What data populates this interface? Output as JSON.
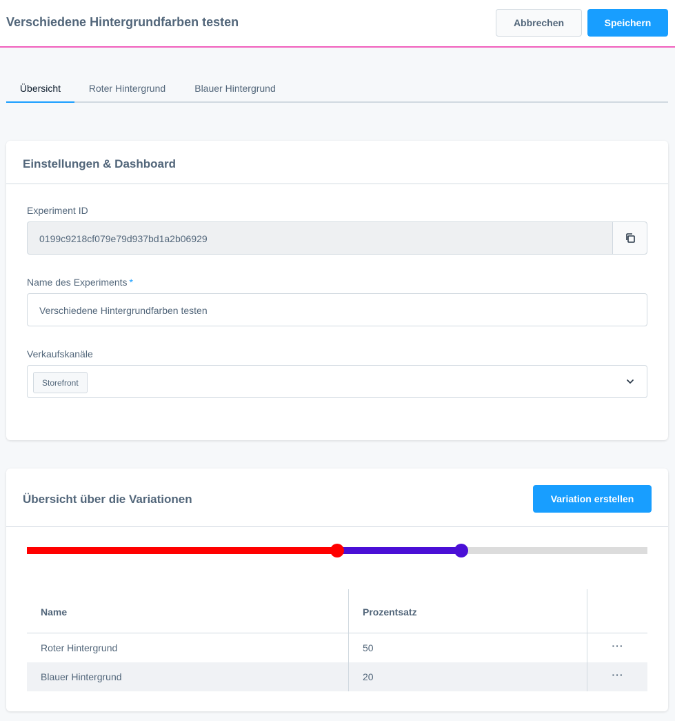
{
  "header": {
    "title": "Verschiedene Hintergrundfarben testen",
    "cancel_label": "Abbrechen",
    "save_label": "Speichern"
  },
  "tabs": [
    {
      "label": "Übersicht",
      "active": true
    },
    {
      "label": "Roter Hintergrund",
      "active": false
    },
    {
      "label": "Blauer Hintergrund",
      "active": false
    }
  ],
  "settings_card": {
    "title": "Einstellungen & Dashboard",
    "experiment_id_label": "Experiment ID",
    "experiment_id_value": "0199c9218cf079e79d937bd1a2b06929",
    "name_label": "Name des Experiments",
    "required_marker": "*",
    "name_value": "Verschiedene Hintergrundfarben testen",
    "channels_label": "Verkaufskanäle",
    "channels_selected": [
      "Storefront"
    ]
  },
  "variations_card": {
    "title": "Übersicht über die Variationen",
    "create_button_label": "Variation erstellen",
    "slider": {
      "segments": [
        {
          "name": "Roter Hintergrund",
          "percent": 50,
          "color": "#ff0000"
        },
        {
          "name": "Blauer Hintergrund",
          "percent": 20,
          "color": "#4a0fd6"
        }
      ],
      "remainder_color": "#dcdcdc"
    },
    "table": {
      "columns": [
        "Name",
        "Prozentsatz",
        ""
      ],
      "rows": [
        {
          "name": "Roter Hintergrund",
          "percent": "50",
          "actions": "···"
        },
        {
          "name": "Blauer Hintergrund",
          "percent": "20",
          "actions": "···"
        }
      ]
    }
  },
  "colors": {
    "accent": "#189eff",
    "header_border": "#f15fbd",
    "text": "#52667a"
  }
}
